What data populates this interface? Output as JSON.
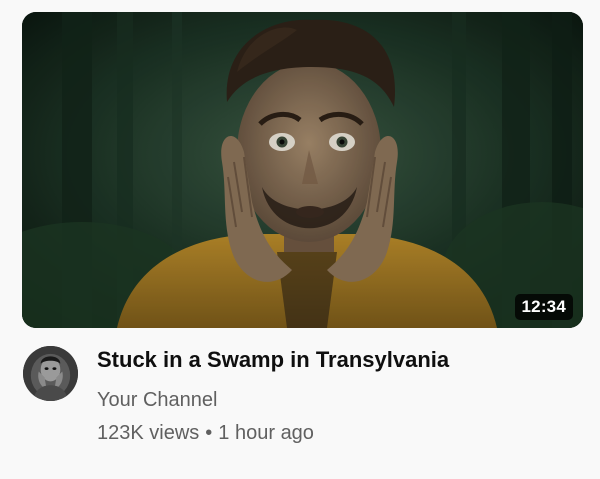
{
  "video": {
    "title": "Stuck in a Swamp in Transylvania",
    "duration": "12:34",
    "channel": "Your Channel",
    "views": "123K views",
    "separator": "•",
    "uploaded": "1 hour ago"
  },
  "colors": {
    "background": "#f9f9f9",
    "title": "#0f0f0f",
    "secondary_text": "#606060",
    "duration_badge": "#000000"
  },
  "icons": {
    "thumbnail": "forest-portrait-thumbnail",
    "avatar": "channel-avatar-portrait"
  }
}
